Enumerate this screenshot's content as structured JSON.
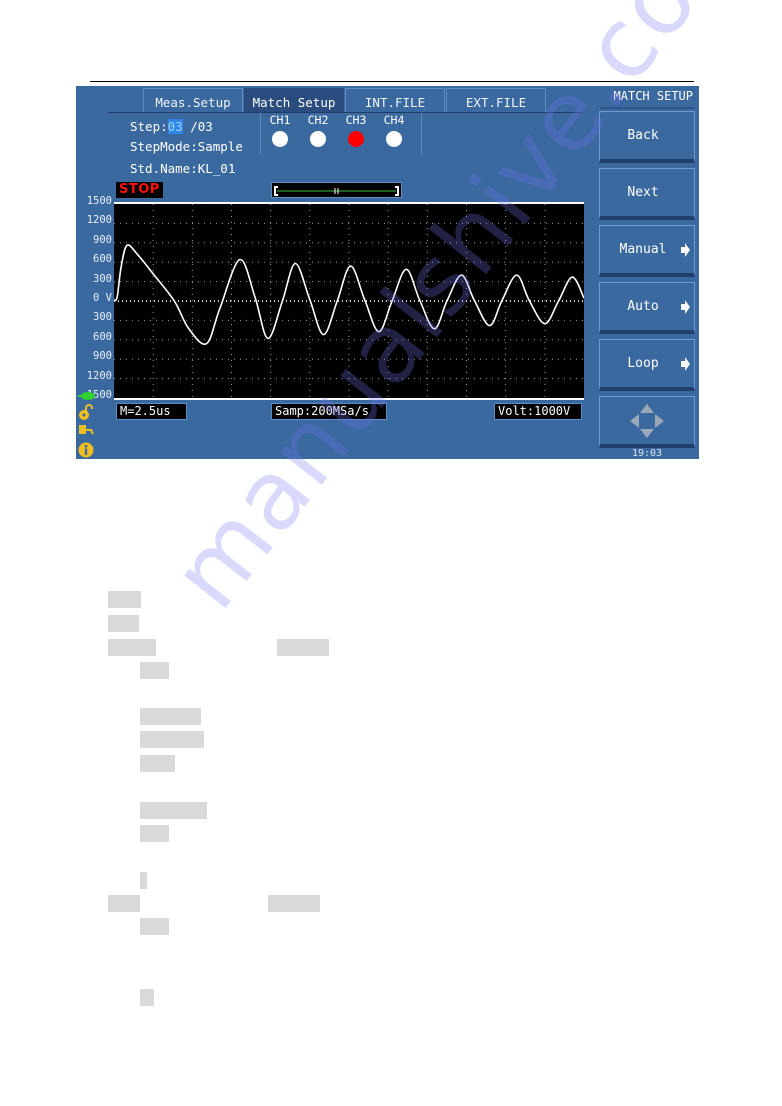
{
  "screen": {
    "tabs": [
      {
        "label": "Meas.Setup",
        "active": false
      },
      {
        "label": "Match Setup",
        "active": true
      },
      {
        "label": "INT.FILE",
        "active": false
      },
      {
        "label": "EXT.FILE",
        "active": false
      }
    ],
    "side_title": "MATCH SETUP",
    "softkeys": [
      {
        "label": "Back",
        "has_arrow": false
      },
      {
        "label": "Next",
        "has_arrow": false
      },
      {
        "label": "Manual",
        "has_arrow": true
      },
      {
        "label": "Auto",
        "has_arrow": true
      },
      {
        "label": "Loop",
        "has_arrow": true
      }
    ],
    "nav_icon": "four-way-arrow-icon",
    "clock": "19:03",
    "info": {
      "step_label": "Step:",
      "step_current": "03",
      "step_total": " /03",
      "step_mode": "StepMode:Sample",
      "std_name": "Std.Name:KL_01"
    },
    "channels": [
      {
        "label": "CH1",
        "color": "#ffffff"
      },
      {
        "label": "CH2",
        "color": "#ffffff"
      },
      {
        "label": "CH3",
        "color": "#ff0000"
      },
      {
        "label": "CH4",
        "color": "#ffffff"
      }
    ],
    "status": "STOP",
    "status_color": "#ff1010",
    "timebase": "M=2.5us",
    "sample_rate": "Samp:200MSa/s",
    "volt_range": "Volt:1000V",
    "status_icons": [
      "connection-icon",
      "unlock-icon",
      "key-icon",
      "info-icon"
    ]
  },
  "chart_data": {
    "type": "line",
    "title": "",
    "xlabel": "",
    "ylabel": "V",
    "x_divisions": 12,
    "xlim": [
      0,
      12
    ],
    "ylim": [
      -1500,
      1500
    ],
    "y_ticks": [
      "1500",
      "1200",
      "900",
      "600",
      "300",
      "0 V",
      "300",
      "600",
      "900",
      "1200",
      "1500"
    ],
    "grid": true,
    "trace_color": "#ffffff",
    "series": [
      {
        "name": "waveform",
        "x": [
          0,
          0.08,
          0.18,
          0.33,
          0.6,
          1.0,
          1.54,
          1.9,
          2.36,
          2.7,
          3.21,
          3.6,
          3.93,
          4.3,
          4.63,
          5.0,
          5.35,
          5.7,
          6.04,
          6.4,
          6.76,
          7.1,
          7.46,
          7.8,
          8.18,
          8.5,
          8.87,
          9.2,
          9.59,
          9.9,
          10.28,
          10.6,
          11.0,
          11.35,
          11.7,
          12.0
        ],
        "y": [
          15,
          60,
          520,
          860,
          720,
          420,
          0,
          -420,
          -660,
          -120,
          640,
          60,
          -580,
          0,
          580,
          20,
          -520,
          0,
          540,
          20,
          -475,
          0,
          490,
          20,
          -430,
          0,
          400,
          10,
          -380,
          0,
          400,
          10,
          -350,
          0,
          370,
          45
        ]
      }
    ]
  },
  "document": {
    "watermark": "manualshive.com"
  }
}
